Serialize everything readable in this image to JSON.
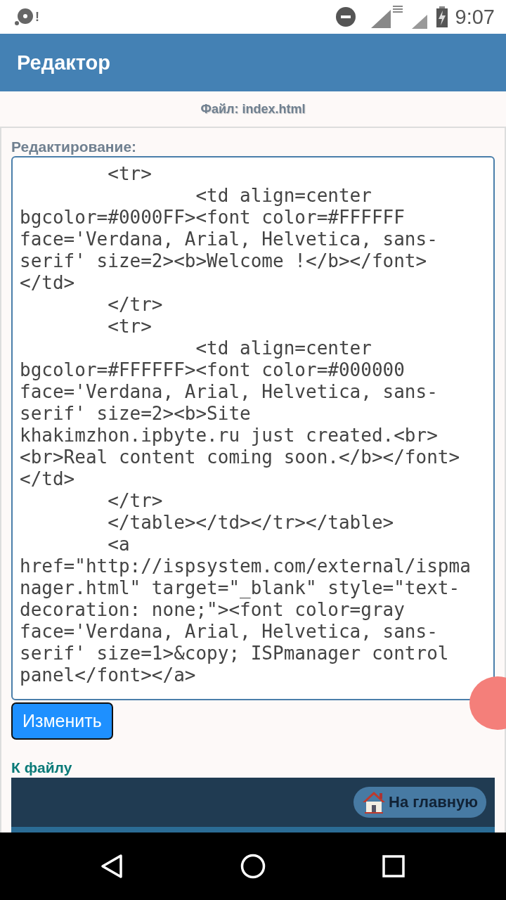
{
  "status_bar": {
    "time": "9:07",
    "notification": "!"
  },
  "app_bar": {
    "title": "Редактор"
  },
  "file_bar": {
    "label": "Файл: index.html"
  },
  "editor": {
    "label": "Редактирование:",
    "lines": [
      "        <tr>",
      "                <td align=center",
      "bgcolor=#0000FF><font color=#FFFFFF",
      "face='Verdana, Arial, Helvetica, sans-",
      "serif' size=2><b>Welcome !</b></font>",
      "</td>",
      "        </tr>",
      "        <tr>",
      "                <td align=center",
      "bgcolor=#FFFFFF><font color=#000000",
      "face='Verdana, Arial, Helvetica, sans-",
      "serif' size=2><b>Site",
      "khakimzhon.ipbyte.ru just created.<br>",
      "<br>Real content coming soon.</b></font>",
      "</td>",
      "        </tr>",
      "        </table></td></tr></table>",
      "        <a",
      "href=\"http://ispsystem.com/external/ispma",
      "nager.html\" target=\"_blank\" style=\"text-",
      "decoration: none;\"><font color=gray",
      "face='Verdana, Arial, Helvetica, sans-",
      "serif' size=1>&copy; ISPmanager control",
      "panel</font></a>"
    ]
  },
  "save_button": {
    "label": "Изменить"
  },
  "file_link": {
    "label": "К файлу"
  },
  "footer": {
    "home_button": "На главную"
  }
}
